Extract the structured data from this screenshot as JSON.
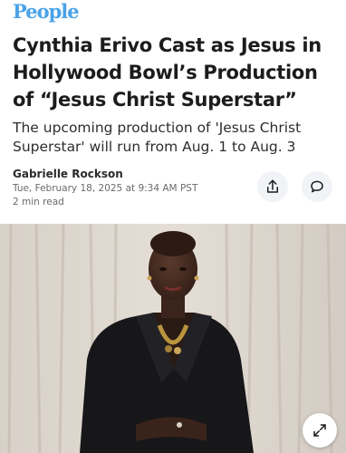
{
  "brand": {
    "logo_text": "People",
    "color": "#4aa3e8"
  },
  "article": {
    "headline": "Cynthia Erivo Cast as Jesus in Hollywood Bowl’s Production of “Jesus Christ Superstar”",
    "dek": "The upcoming production of 'Jesus Christ Superstar' will run from Aug. 1 to Aug. 3",
    "author": "Gabrielle Rockson",
    "date": "Tue, February 18, 2025 at 9:34 AM PST",
    "read_time": "2 min read"
  },
  "actions": {
    "share_icon": "share-icon",
    "comment_icon": "comment-icon",
    "expand_icon": "expand-icon"
  },
  "colors": {
    "text": "#1c1c1c",
    "muted": "#6a6a6a",
    "button_bg": "#f1f3f6"
  }
}
